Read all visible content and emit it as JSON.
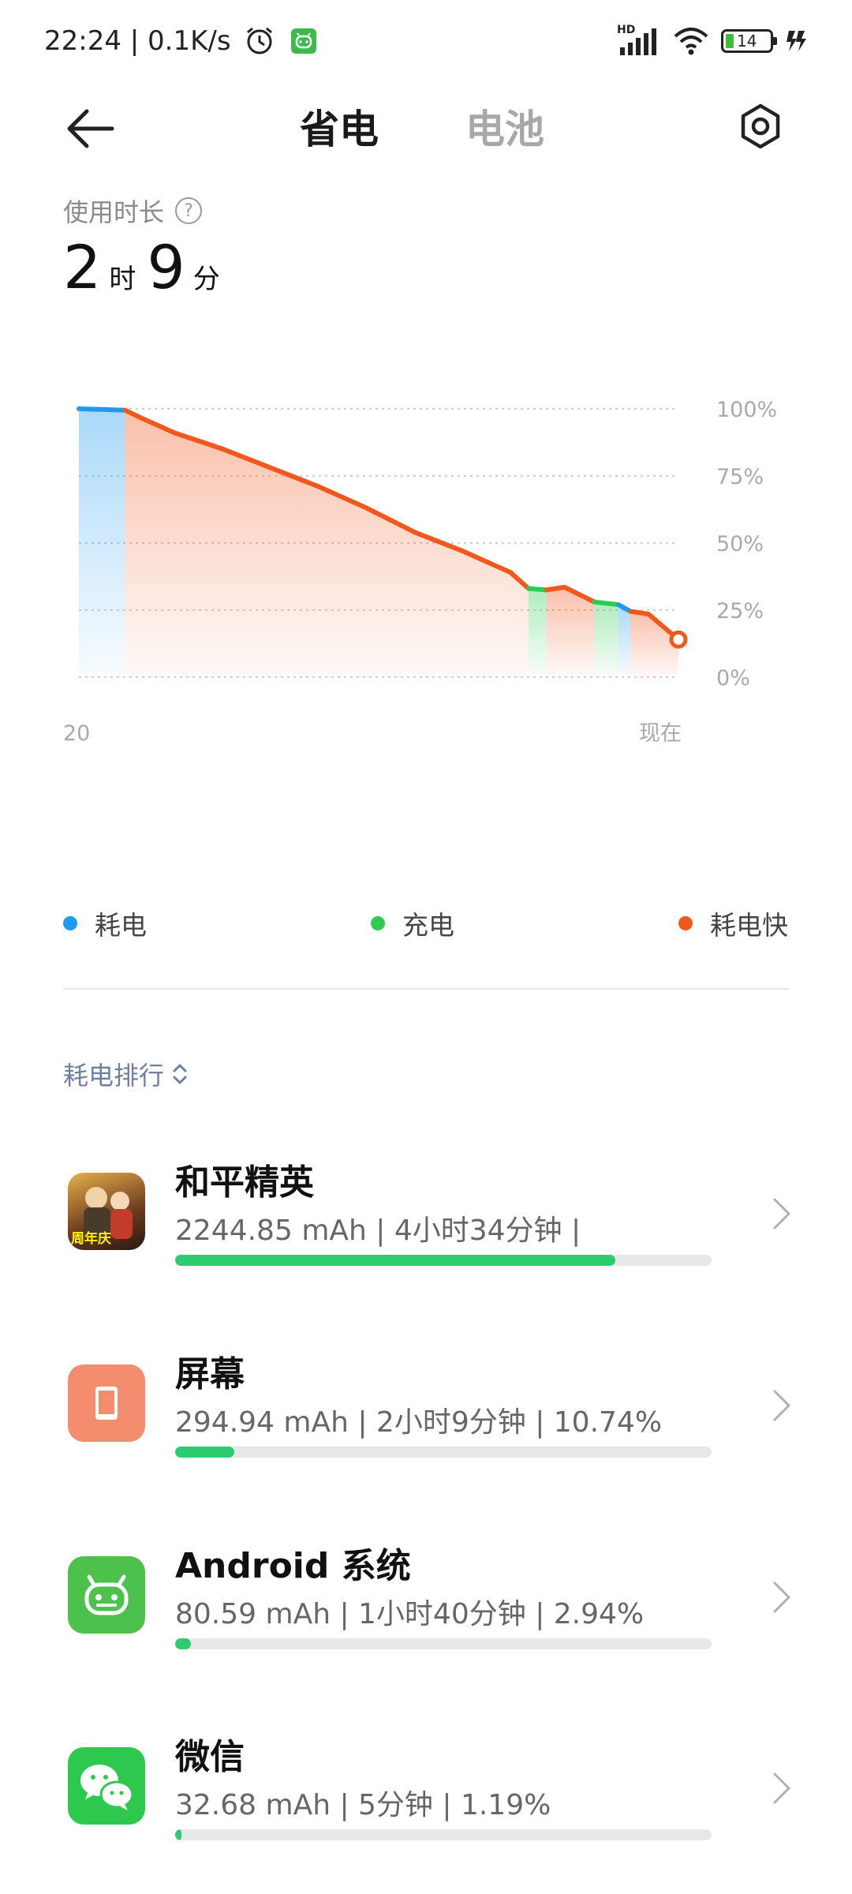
{
  "status_bar": {
    "time": "22:24 | 0.1K/s",
    "network_badge": "HD",
    "battery_level": "14",
    "icons": [
      "alarm-icon",
      "android-notify-icon",
      "signal-icon",
      "wifi-icon",
      "battery-icon",
      "charging-icon"
    ]
  },
  "header": {
    "tabs": [
      {
        "label": "省电",
        "active": true
      },
      {
        "label": "电池",
        "active": false
      }
    ]
  },
  "usage": {
    "label": "使用时长",
    "hours": "2",
    "hours_unit": "时",
    "minutes": "9",
    "minutes_unit": "分"
  },
  "chart_data": {
    "type": "line",
    "y_ticks": [
      "100%",
      "75%",
      "50%",
      "25%",
      "0%"
    ],
    "ylim": [
      0,
      100
    ],
    "x_labels": {
      "start": "20",
      "end": "现在"
    },
    "series": [
      {
        "name": "耗电",
        "color": "#1e9bf0",
        "points": [
          [
            0,
            100
          ],
          [
            0.077,
            99.5
          ]
        ]
      },
      {
        "name": "耗电快",
        "color": "#f0581e",
        "points": [
          [
            0.077,
            99.5
          ],
          [
            0.1,
            97
          ],
          [
            0.16,
            91
          ],
          [
            0.24,
            85
          ],
          [
            0.32,
            78
          ],
          [
            0.4,
            71
          ],
          [
            0.48,
            63
          ],
          [
            0.56,
            54
          ],
          [
            0.64,
            47
          ],
          [
            0.72,
            39
          ],
          [
            0.75,
            33
          ]
        ]
      },
      {
        "name": "充电",
        "color": "#2ecc55",
        "points": [
          [
            0.75,
            33
          ],
          [
            0.78,
            32.5
          ]
        ]
      },
      {
        "name": "耗电快",
        "color": "#f0581e",
        "points": [
          [
            0.78,
            32.5
          ],
          [
            0.81,
            33.5
          ],
          [
            0.86,
            28
          ]
        ]
      },
      {
        "name": "充电",
        "color": "#2ecc55",
        "points": [
          [
            0.86,
            28
          ],
          [
            0.9,
            27
          ]
        ]
      },
      {
        "name": "耗电",
        "color": "#1e9bf0",
        "points": [
          [
            0.9,
            27
          ],
          [
            0.92,
            24.5
          ]
        ]
      },
      {
        "name": "耗电快",
        "color": "#f0581e",
        "points": [
          [
            0.92,
            24.5
          ],
          [
            0.95,
            23.5
          ],
          [
            1.0,
            14
          ]
        ]
      }
    ],
    "current_value": 14
  },
  "legend": [
    {
      "label": "耗电",
      "color": "#1e9bf0"
    },
    {
      "label": "充电",
      "color": "#2ecc55"
    },
    {
      "label": "耗电快",
      "color": "#f0581e"
    }
  ],
  "ranking": {
    "label": "耗电排行"
  },
  "apps": [
    {
      "name": "和平精英",
      "detail": "2244.85 mAh | 4小时34分钟 |",
      "progress": 0.82,
      "icon": "game-icon",
      "icon_text": "周年庆"
    },
    {
      "name": "屏幕",
      "detail": "294.94 mAh | 2小时9分钟 | 10.74%",
      "progress": 0.11,
      "icon": "screen-icon"
    },
    {
      "name": "Android 系统",
      "detail": "80.59 mAh | 1小时40分钟 | 2.94%",
      "progress": 0.03,
      "icon": "android-icon"
    },
    {
      "name": "微信",
      "detail": "32.68 mAh | 5分钟 | 1.19%",
      "progress": 0.012,
      "icon": "wechat-icon"
    }
  ]
}
